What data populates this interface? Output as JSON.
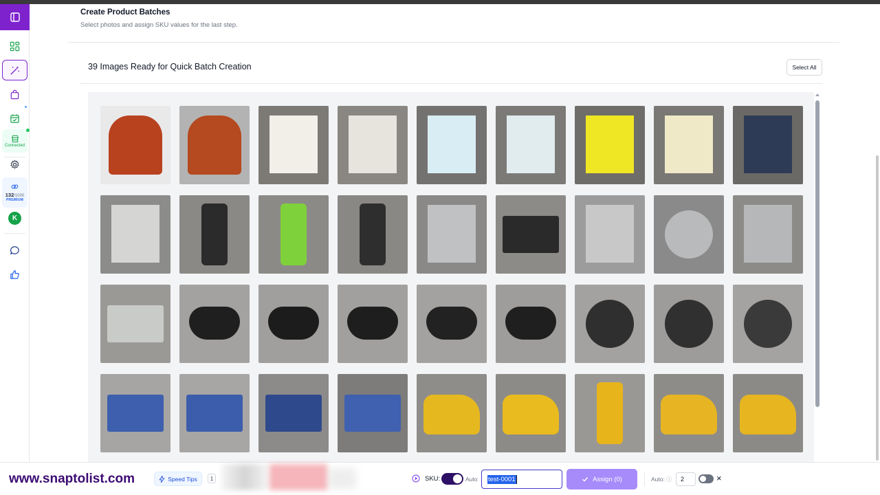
{
  "header": {
    "title": "Create Product Batches",
    "subtitle": "Select photos and assign SKU values for the last step."
  },
  "sidebar": {
    "connected_label": "Connected",
    "credits_used": "132",
    "credits_total": "/1000",
    "plan": "PREMIUM",
    "avatar_initial": "K"
  },
  "gallery": {
    "ready_text": "39 Images Ready for Quick Batch Creation",
    "select_all_label": "Select All",
    "images": [
      {
        "subject": "orange-floral-blouse"
      },
      {
        "subject": "orange-floral-blouse-closeup"
      },
      {
        "subject": "classics-ii-record-front"
      },
      {
        "subject": "classics-ii-record-back"
      },
      {
        "subject": "danger-zone-record-front"
      },
      {
        "subject": "danger-zone-record-back"
      },
      {
        "subject": "man-of-la-mancha-record-front"
      },
      {
        "subject": "man-of-la-mancha-record-back"
      },
      {
        "subject": "engelbert-record-front"
      },
      {
        "subject": "group-photo-record"
      },
      {
        "subject": "green-tool-package-front"
      },
      {
        "subject": "green-tool-package-angle"
      },
      {
        "subject": "green-tool-package-back"
      },
      {
        "subject": "dvd-drive-top"
      },
      {
        "subject": "dvd-drive-front"
      },
      {
        "subject": "dvd-drive-label"
      },
      {
        "subject": "dvd-drive-bottom"
      },
      {
        "subject": "dvd-drive-plate"
      },
      {
        "subject": "dvd-drive-side"
      },
      {
        "subject": "xbox-controller-front"
      },
      {
        "subject": "xbox-controller-closeup"
      },
      {
        "subject": "xbox-controller-angle"
      },
      {
        "subject": "xbox-controller-top"
      },
      {
        "subject": "xbox-controller-battery"
      },
      {
        "subject": "amd-cooler-top"
      },
      {
        "subject": "amd-cooler-closeup"
      },
      {
        "subject": "amd-cooler-side"
      },
      {
        "subject": "kingston-ram-pair"
      },
      {
        "subject": "kingston-ram-pair-2"
      },
      {
        "subject": "kingston-ram-labels"
      },
      {
        "subject": "kingston-ram-closeup"
      },
      {
        "subject": "yellow-nike-dunks-pair"
      },
      {
        "subject": "yellow-nike-dunks-side"
      },
      {
        "subject": "yellow-nike-dunk-sole"
      },
      {
        "subject": "yellow-nike-dunks-box"
      },
      {
        "subject": "yellow-nike-dunks-angle"
      }
    ]
  },
  "bottombar": {
    "site_url": "www.snaptolist.com",
    "speed_tips_label": "Speed Tips",
    "tips_count": "1",
    "sku_label": "SKU:",
    "auto_label": "Auto",
    "sku_value": "test-0001",
    "assign_label": "Assign (0)",
    "auto_count_label": "Auto:",
    "auto_count_value": "2",
    "close_label": "×"
  },
  "colors": {
    "brand_purple": "#7e22ce",
    "assign_button": "#a78bfa",
    "toggle_dark": "#2e1065",
    "connected_green": "#16a34a"
  }
}
